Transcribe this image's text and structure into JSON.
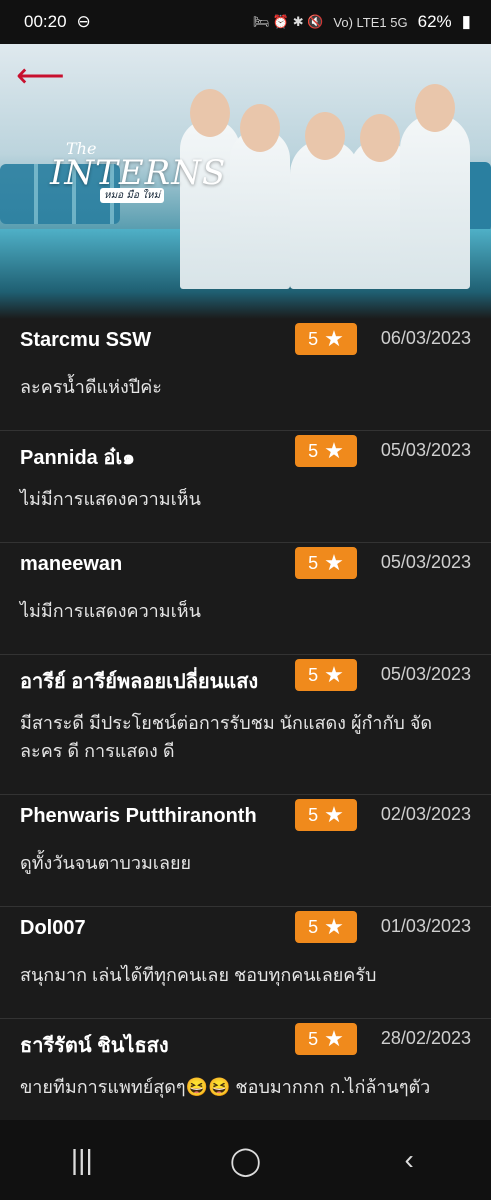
{
  "status_bar": {
    "time": "00:20",
    "battery": "62%",
    "signal_labels": "Vo) LTE1 5G"
  },
  "header": {
    "logo_the": "The",
    "logo_main": "INTERNS",
    "logo_sub": "หมอ มือ ใหม่"
  },
  "reviews": [
    {
      "name": "Starcmu SSW",
      "rating": "5",
      "date": "06/03/2023",
      "comment": "ละครน้ำดีแห่งปีค่ะ"
    },
    {
      "name": "Pannida อ๋เ๑",
      "rating": "5",
      "date": "05/03/2023",
      "comment": "ไม่มีการแสดงความเห็น"
    },
    {
      "name": "maneewan",
      "rating": "5",
      "date": "05/03/2023",
      "comment": "ไม่มีการแสดงความเห็น"
    },
    {
      "name": "อารีย์ อารีย์พลอยเปลี่ยนแสง",
      "rating": "5",
      "date": "05/03/2023",
      "comment": "มีสาระดี มีประโยชน์ต่อการรับชม นักแสดง ผู้กำกับ จัดละคร ดี การแสดง ดี"
    },
    {
      "name": "Phenwaris Putthiranonth",
      "rating": "5",
      "date": "02/03/2023",
      "comment": "ดูทั้งวันจนตาบวมเลยย"
    },
    {
      "name": "Dol007",
      "rating": "5",
      "date": "01/03/2023",
      "comment": "สนุกมาก เล่นได้ทีทุกคนเลย ชอบทุกคนเลยครับ"
    },
    {
      "name": "ธารีรัตน์ ชินไธสง",
      "rating": "5",
      "date": "28/02/2023",
      "comment": "ขายทีมการแพทย์สุดๆ😆😆 ชอบมากกก ก.ไก่ล้านๆตัว"
    }
  ],
  "icons": {
    "back": "back-arrow-icon",
    "star": "star-icon",
    "recents": "recents-icon",
    "home": "home-icon",
    "nav_back": "nav-back-icon"
  },
  "colors": {
    "accent": "#f08a1c",
    "back_arrow": "#c8102e",
    "background": "#1b1b1b"
  }
}
